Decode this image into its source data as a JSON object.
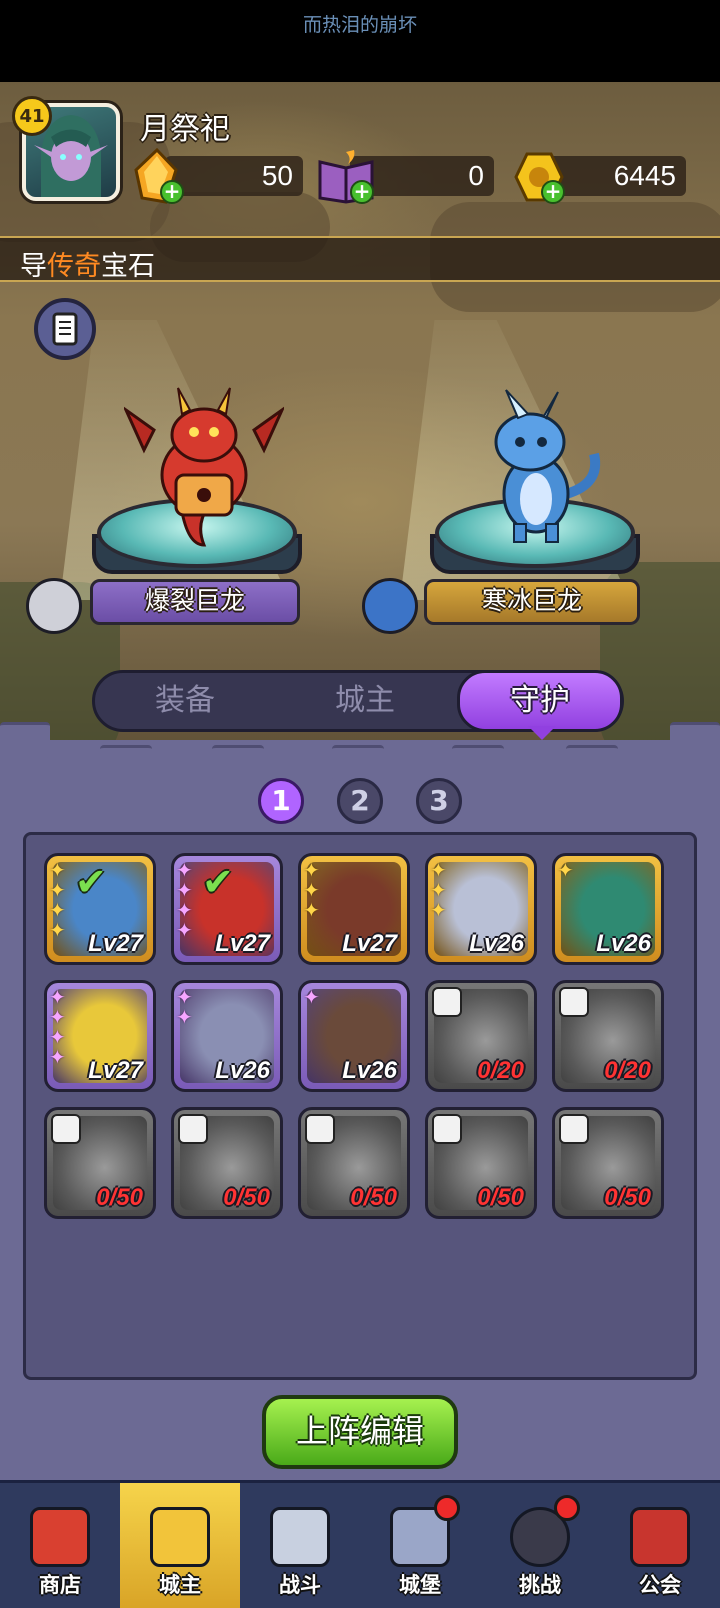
{
  "system": {
    "ticker": "而热泪的崩坏"
  },
  "player": {
    "level": "41",
    "name": "月祭祀"
  },
  "resources": [
    {
      "name": "amber-crystal",
      "value": "50"
    },
    {
      "name": "spell-book",
      "value": "0"
    },
    {
      "name": "gold-coin",
      "value": "6445"
    }
  ],
  "banner": {
    "prefix": "导",
    "highlight": "传奇",
    "suffix": "宝石"
  },
  "dragons": [
    {
      "name": "爆裂巨龙",
      "color": "#d63a2e"
    },
    {
      "name": "寒冰巨龙",
      "color": "#4a8fd6"
    }
  ],
  "tabs": [
    {
      "label": "装备",
      "active": false
    },
    {
      "label": "城主",
      "active": false
    },
    {
      "label": "守护",
      "active": true
    }
  ],
  "pages": [
    "1",
    "2",
    "3"
  ],
  "active_page": "1",
  "cards": [
    {
      "frame": "gold",
      "stars": 4,
      "star_color": "gold",
      "level": "Lv27",
      "checked": true,
      "color": "#4a86c8"
    },
    {
      "frame": "purple",
      "stars": 4,
      "star_color": "pink",
      "level": "Lv27",
      "checked": true,
      "color": "#c8322a"
    },
    {
      "frame": "gold",
      "stars": 3,
      "star_color": "gold",
      "level": "Lv27",
      "checked": false,
      "color": "#7a3a2a"
    },
    {
      "frame": "gold",
      "stars": 3,
      "star_color": "gold",
      "level": "Lv26",
      "checked": false,
      "color": "#b9c0d6"
    },
    {
      "frame": "gold",
      "stars": 1,
      "star_color": "gold",
      "level": "Lv26",
      "checked": false,
      "color": "#2f8a72"
    },
    {
      "frame": "purple",
      "stars": 4,
      "star_color": "pink",
      "level": "Lv27",
      "checked": false,
      "color": "#e8c83a"
    },
    {
      "frame": "purple",
      "stars": 2,
      "star_color": "pink",
      "level": "Lv26",
      "checked": false,
      "color": "#8a8fb3"
    },
    {
      "frame": "purple",
      "stars": 1,
      "star_color": "pink",
      "level": "Lv26",
      "checked": false,
      "color": "#6a4a3a"
    },
    {
      "frame": "locked",
      "progress": "0/20"
    },
    {
      "frame": "locked",
      "progress": "0/20"
    },
    {
      "frame": "locked",
      "progress": "0/50"
    },
    {
      "frame": "locked",
      "progress": "0/50"
    },
    {
      "frame": "locked",
      "progress": "0/50"
    },
    {
      "frame": "locked",
      "progress": "0/50"
    },
    {
      "frame": "locked",
      "progress": "0/50"
    }
  ],
  "deploy_button": "上阵编辑",
  "nav": [
    {
      "label": "商店",
      "icon": "shop-icon",
      "active": false,
      "badge": false
    },
    {
      "label": "城主",
      "icon": "crown-icon",
      "active": true,
      "badge": false
    },
    {
      "label": "战斗",
      "icon": "crossed-swords-icon",
      "active": false,
      "badge": false
    },
    {
      "label": "城堡",
      "icon": "castle-icon",
      "active": false,
      "badge": true
    },
    {
      "label": "挑战",
      "icon": "bomb-icon",
      "active": false,
      "badge": true
    },
    {
      "label": "公会",
      "icon": "guild-banner-icon",
      "active": false,
      "badge": false
    }
  ]
}
